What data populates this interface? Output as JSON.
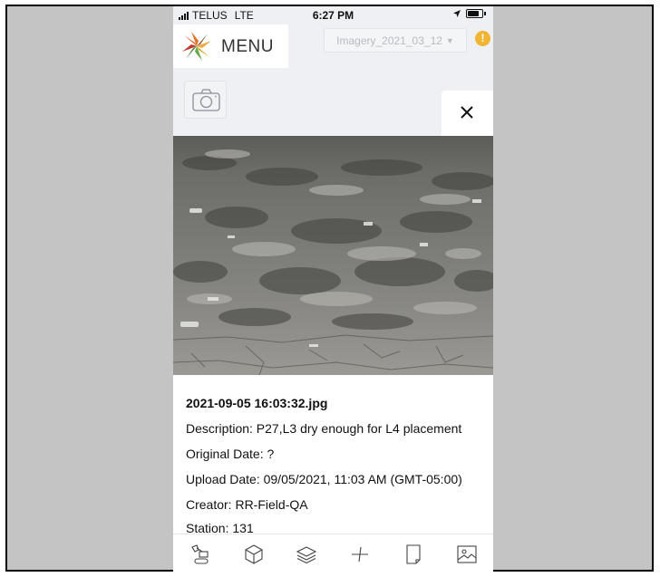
{
  "status_bar": {
    "carrier": "TELUS",
    "network": "LTE",
    "time": "6:27 PM"
  },
  "header": {
    "menu_label": "MENU",
    "imagery_select": "Imagery_2021_03_12",
    "alert_symbol": "!"
  },
  "photo_details": {
    "filename": "2021-09-05 16:03:32.jpg",
    "description": "Description: P27,L3 dry enough for L4 placement",
    "original_date": "Original Date: ?",
    "upload_date": "Upload Date: 09/05/2021, 11:03 AM (GMT-05:00)",
    "creator": "Creator: RR-Field-QA",
    "station": "Station: 131"
  },
  "toolbar": {
    "icons": [
      "excavator-icon",
      "cube-icon",
      "layers-icon",
      "crosshair-icon",
      "document-icon",
      "image-icon"
    ]
  },
  "colors": {
    "alert": "#f0b533",
    "background": "#eef0f3",
    "frame": "#c4c4c4"
  }
}
